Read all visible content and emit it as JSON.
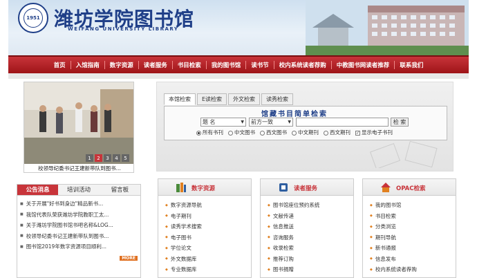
{
  "header": {
    "logo_cn": "潍坊学院图书馆",
    "logo_en": "WEIFANG UNIVERSITY LIBRARY",
    "seal_text": "1951"
  },
  "nav": [
    "首页",
    "入馆指南",
    "数字资源",
    "读者服务",
    "书目检索",
    "我的图书馆",
    "读书节",
    "校内系统读者荐购",
    "中教图书网读者推荐",
    "联系我们"
  ],
  "slideshow": {
    "caption": "校领导纪委书记王建新带队到图书...",
    "dots": [
      "1",
      "2",
      "3",
      "4",
      "5"
    ],
    "active_dot": "2"
  },
  "search": {
    "tabs": [
      "本馆检索",
      "E读检索",
      "外文检索",
      "读秀检索"
    ],
    "active_tab": "本馆检索",
    "title": "馆藏书目简单检索",
    "field_select": "题  名",
    "match_select": "前方一致",
    "query_value": "",
    "button": "检 索",
    "options": [
      "所有书刊",
      "中文图书",
      "西文图书",
      "中文期刊",
      "西文期刊"
    ],
    "selected_option": "所有书刊",
    "checkbox_label": "显示电子书刊",
    "checkbox_checked": true
  },
  "news": {
    "tabs": [
      "公告消息",
      "培训活动",
      "留言板"
    ],
    "active_tab": "公告消息",
    "items": [
      "关于开展\"好书到身边\"精品新书...",
      "我馆代表队荣获潍坊学院教职工太...",
      "关于潍坊学院图书馆书吧名称&LOG...",
      "校领导纪委书记王建新带队到图书...",
      "图书馆2019年数字资源项目顺利..."
    ],
    "more": "MORE"
  },
  "panels": [
    {
      "title": "数字资源",
      "icon": "books-icon",
      "color": "#4a8a3a",
      "items": [
        "数字资源导航",
        "电子期刊",
        "读秀学术搜索",
        "电子图书",
        "学位论文",
        "外文数据库",
        "专业数据库"
      ]
    },
    {
      "title": "读者服务",
      "icon": "phone-icon",
      "color": "#2f5fa0",
      "items": [
        "图书馆座位预约系统",
        "文献传递",
        "信息推送",
        "咨询服务",
        "收录检索",
        "推荐订购",
        "图书捐赠"
      ]
    },
    {
      "title": "OPAC检索",
      "icon": "house-icon",
      "color": "#c8343a",
      "items": [
        "我的图书馆",
        "书目检索",
        "分类浏览",
        "期刊导航",
        "新书通报",
        "信息发布",
        "校内系统读者荐购"
      ]
    }
  ]
}
